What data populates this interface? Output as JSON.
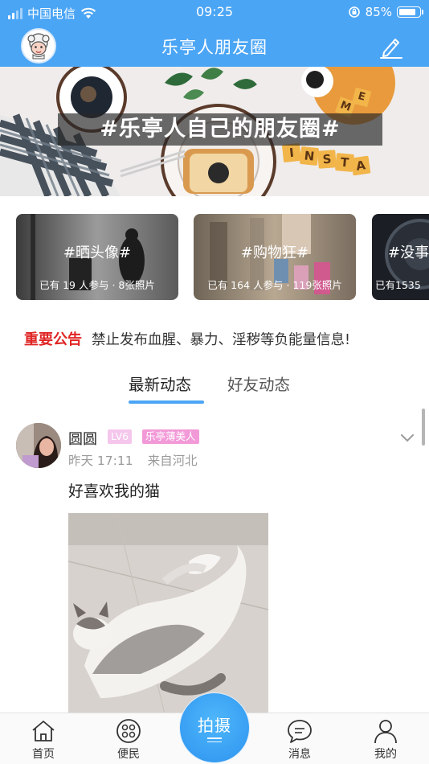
{
  "status_bar": {
    "carrier": "中国电信",
    "time": "09:25",
    "battery": "85%",
    "battery_level": 0.85,
    "icons": [
      "signal-icon",
      "wifi-icon",
      "orientation-lock-icon",
      "battery-icon"
    ]
  },
  "header": {
    "title": "乐亭人朋友圈",
    "left_icon": "sheep-avatar-icon",
    "right_icon": "edit-icon"
  },
  "banner": {
    "caption": "#乐亭人自己的朋友圈#",
    "lettering": "INSTA ME"
  },
  "topics": [
    {
      "name": "#晒头像#",
      "stats": "已有 19 人参与 · 8张照片"
    },
    {
      "name": "#购物狂#",
      "stats": "已有 164 人参与 · 119张照片"
    },
    {
      "name": "#没事",
      "stats": "已有1535"
    }
  ],
  "notice": {
    "label": "重要公告",
    "text": "禁止发布血腥、暴力、淫秽等负能量信息!"
  },
  "feed_tabs": [
    {
      "label": "最新动态",
      "active": true
    },
    {
      "label": "好友动态",
      "active": false
    }
  ],
  "post": {
    "author": "圆圆",
    "level": "LV6",
    "title_badge": "乐亭薄美人",
    "time": "昨天 17:11",
    "location": "来自河北",
    "text": "好喜欢我的猫",
    "expand_icon": "chevron-down-icon"
  },
  "tabbar": {
    "items": [
      {
        "label": "首页",
        "icon": "home-icon"
      },
      {
        "label": "便民",
        "icon": "grid-icon"
      },
      {
        "label": "消息",
        "icon": "message-icon"
      },
      {
        "label": "我的",
        "icon": "user-icon"
      }
    ],
    "center_button": "拍摄"
  },
  "colors": {
    "brand_blue": "#4ba5f5",
    "notice_red": "#e02525",
    "badge_pink": "#f29ad8",
    "badge_light_pink": "#f5c6ec"
  }
}
